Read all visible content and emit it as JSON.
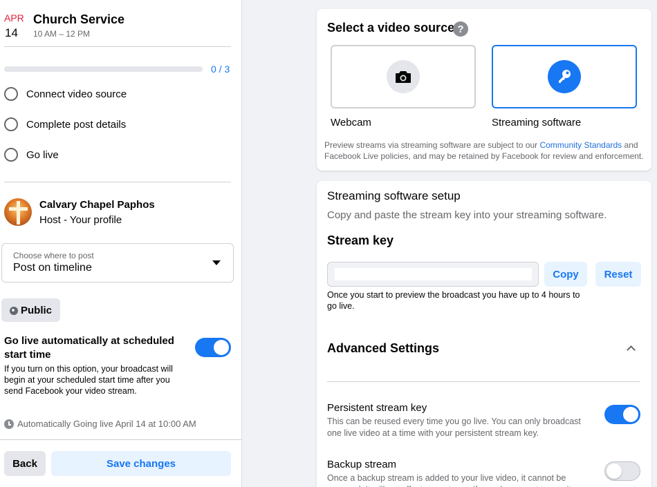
{
  "event": {
    "month": "APR",
    "day": "14",
    "title": "Church Service",
    "time": "10 AM – 12 PM"
  },
  "progress": {
    "count_label": "0 / 3",
    "completed_fraction": 0
  },
  "steps": [
    {
      "label": "Connect video source"
    },
    {
      "label": "Complete post details"
    },
    {
      "label": "Go live"
    }
  ],
  "host": {
    "name": "Calvary Chapel Paphos",
    "role": "Host - Your profile"
  },
  "post_location": {
    "label": "Choose where to post",
    "value": "Post on timeline"
  },
  "audience": {
    "label": "Public"
  },
  "go_live_auto": {
    "title": "Go live automatically at scheduled start time",
    "description": "If you turn on this option, your broadcast will begin at your scheduled start time after you send Facebook your video stream.",
    "enabled": true,
    "status": "Automatically Going live April 14 at 10:00 AM"
  },
  "footer": {
    "back_label": "Back",
    "save_label": "Save changes"
  },
  "video_source": {
    "title": "Select a video source",
    "help_symbol": "?",
    "options": [
      {
        "label": "Webcam",
        "icon": "camera-icon",
        "selected": false
      },
      {
        "label": "Streaming software",
        "icon": "key-icon",
        "selected": true
      }
    ],
    "note_before": "Preview streams via streaming software are subject to our ",
    "note_link": "Community Standards",
    "note_after": " and Facebook Live policies, and may be retained by Facebook for review and enforcement."
  },
  "setup": {
    "title": "Streaming software setup",
    "subtitle": "Copy and paste the stream key into your streaming software.",
    "stream_key_title": "Stream key",
    "stream_key_value": "",
    "copy_label": "Copy",
    "reset_label": "Reset",
    "key_note": "Once you start to preview the broadcast you have up to 4 hours to go live.",
    "advanced_title": "Advanced Settings",
    "options": [
      {
        "title": "Persistent stream key",
        "description": "This can be reused every time you go live. You can only broadcast one live video at a time with your persistent stream key.",
        "enabled": true
      },
      {
        "title": "Backup stream",
        "description": "Once a backup stream is added to your live video, it cannot be removed. It will not affect your stream if you choose not to use it.",
        "enabled": false
      }
    ]
  },
  "colors": {
    "accent": "#1877f2",
    "accent_light": "#e7f3ff",
    "date_red": "#e41e3f",
    "background": "#f0f2f5"
  }
}
